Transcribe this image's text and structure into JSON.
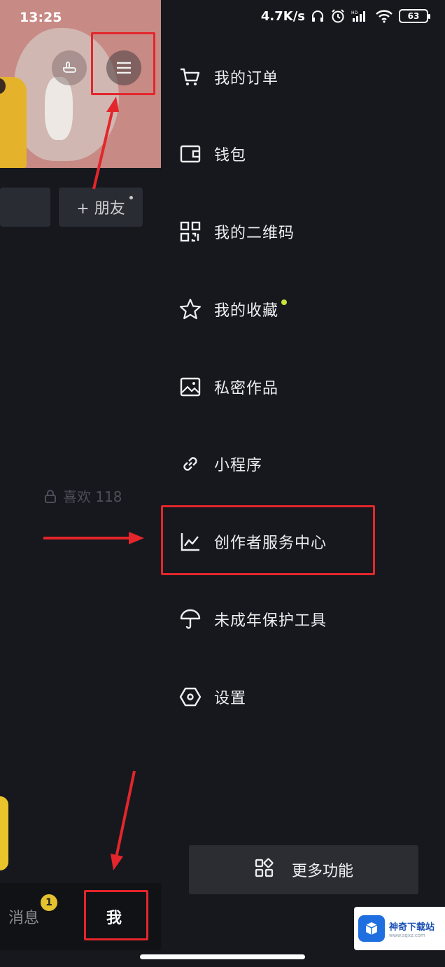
{
  "status_bar": {
    "time": "13:25",
    "network_speed": "4.7K/s",
    "battery": "63"
  },
  "profile": {
    "add_friend_label": "+ 朋友",
    "likes_label": "喜欢 118"
  },
  "bottom_nav": {
    "messages_label": "消息",
    "messages_badge": "1",
    "me_label": "我"
  },
  "drawer": {
    "items": [
      {
        "label": "我的订单",
        "icon": "shopping-cart-icon"
      },
      {
        "label": "钱包",
        "icon": "wallet-icon"
      },
      {
        "label": "我的二维码",
        "icon": "qr-code-icon"
      },
      {
        "label": "我的收藏",
        "icon": "star-icon"
      },
      {
        "label": "私密作品",
        "icon": "image-icon"
      },
      {
        "label": "小程序",
        "icon": "link-icon"
      },
      {
        "label": "创作者服务中心",
        "icon": "line-chart-icon"
      },
      {
        "label": "未成年保护工具",
        "icon": "umbrella-icon"
      },
      {
        "label": "设置",
        "icon": "settings-hexagon-icon"
      }
    ],
    "more_label": "更多功能"
  },
  "watermark": {
    "name": "神奇下载站",
    "url": "www.sqxz.com"
  },
  "colors": {
    "background": "#16181e",
    "highlight": "#e3262b",
    "accent_dot": "#c7e33a",
    "badge": "#e5c12f"
  }
}
